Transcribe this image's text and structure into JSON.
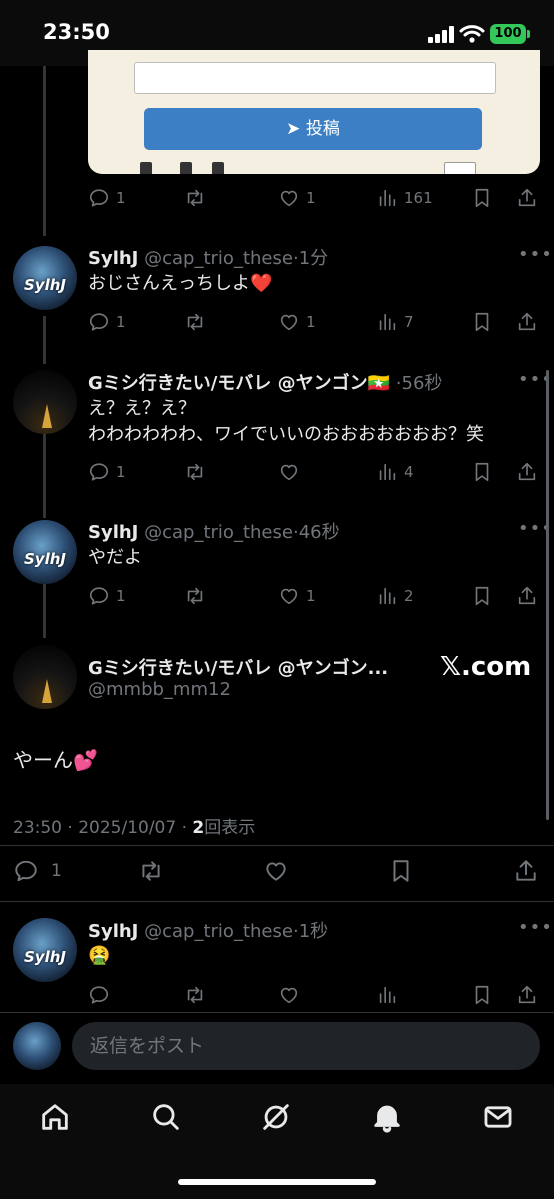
{
  "status_bar": {
    "time": "23:50",
    "battery": "100"
  },
  "top_card": {
    "post_button": "投稿"
  },
  "tweets": [
    {
      "actions": {
        "replies": "1",
        "retweets": "",
        "likes": "1",
        "views": "161"
      }
    },
    {
      "name": "SylhJ",
      "handle": "@cap_trio_these",
      "time": "1分",
      "avatar_text": "SylhJ",
      "lines": [
        "おじさんえっちしよ❤️"
      ],
      "actions": {
        "replies": "1",
        "retweets": "",
        "likes": "1",
        "views": "7"
      }
    },
    {
      "name": "Gミシ行きたい/モバレ @ヤンゴン🇲🇲",
      "handle": "",
      "time": "56秒",
      "lines": [
        "え？え？え？",
        "わわわわわわ、ワイでいいのおおおおおおお？笑"
      ],
      "actions": {
        "replies": "1",
        "retweets": "",
        "likes": "",
        "views": "4"
      }
    },
    {
      "name": "SylhJ",
      "handle": "@cap_trio_these",
      "time": "46秒",
      "avatar_text": "SylhJ",
      "lines": [
        "やだよ"
      ],
      "actions": {
        "replies": "1",
        "retweets": "",
        "likes": "1",
        "views": "2"
      }
    }
  ],
  "focus": {
    "name": "Gミシ行きたい/モバレ @ヤンゴン...",
    "handle": "@mmbb_mm12",
    "badge": "𝕏.com",
    "text": "やーん💕",
    "timestamp": "23:50 · 2025/10/07 · ",
    "views_count": "2",
    "views_label": "回表示",
    "replies": "1"
  },
  "last_reply": {
    "name": "SylhJ",
    "handle": "@cap_trio_these",
    "time": "1秒",
    "avatar_text": "SylhJ",
    "text": "🤮"
  },
  "reply_bar": {
    "placeholder": "返信をポスト"
  },
  "nav": [
    "home-icon",
    "search-icon",
    "grok-icon",
    "notifications-icon",
    "messages-icon"
  ]
}
